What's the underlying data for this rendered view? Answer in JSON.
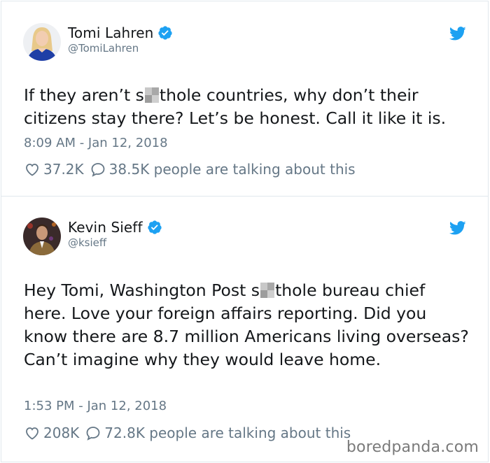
{
  "tweets": [
    {
      "display_name": "Tomi Lahren",
      "handle": "@TomiLahren",
      "text_part1": "If they aren’t s",
      "text_part2": "thole countries, why don’t their citizens stay there? Let’s be honest. Call it like it is.",
      "timestamp": "8:09 AM - Jan 12, 2018",
      "likes": "37.2K",
      "talking": "38.5K people are talking about this",
      "icons": [
        "avatar",
        "verified-icon",
        "twitter-bird-icon",
        "heart-icon",
        "reply-icon"
      ]
    },
    {
      "display_name": "Kevin Sieff",
      "handle": "@ksieff",
      "text_part1": "Hey Tomi, Washington Post s",
      "text_part2": "thole bureau chief here. Love your foreign affairs reporting. Did you know there are 8.7 million Americans living overseas? Can’t imagine why they would leave home.",
      "timestamp": "1:53 PM - Jan 12, 2018",
      "likes": "208K",
      "talking": "72.8K people are talking about this",
      "icons": [
        "avatar",
        "verified-icon",
        "twitter-bird-icon",
        "heart-icon",
        "reply-icon"
      ]
    }
  ],
  "watermark": "boredpanda.com",
  "colors": {
    "text": "#14171a",
    "secondary": "#657786",
    "twitter_blue": "#1da1f2",
    "border": "#e1e8ed"
  }
}
